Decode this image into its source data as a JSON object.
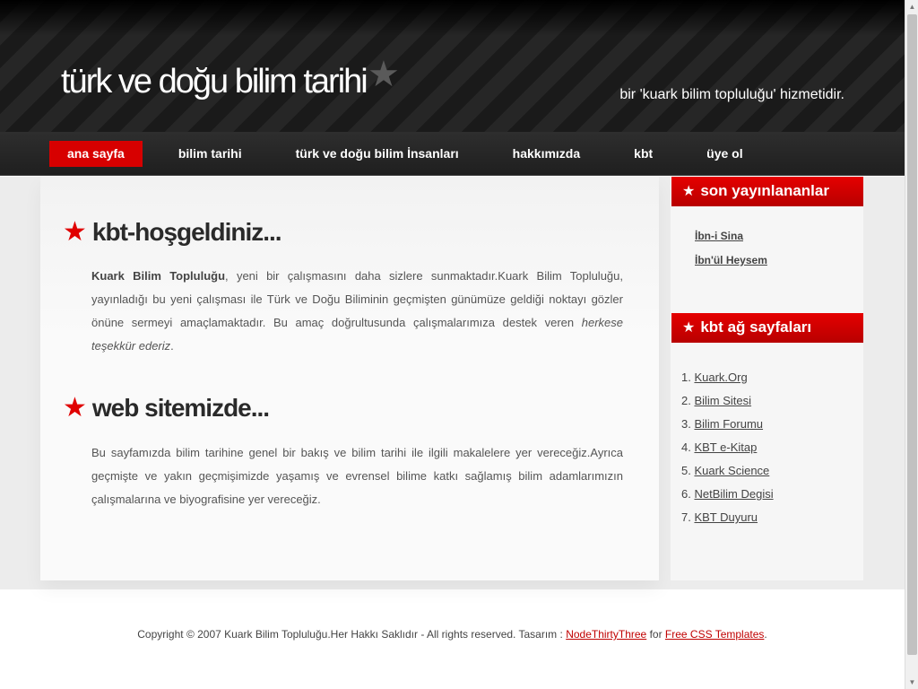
{
  "header": {
    "title": "türk ve doğu bilim tarihi",
    "title_star": "★",
    "tagline": "bir 'kuark bilim topluluğu' hizmetidir."
  },
  "nav": {
    "items": [
      {
        "label": "ana sayfa",
        "active": true
      },
      {
        "label": "bilim tarihi"
      },
      {
        "label": "türk ve doğu bilim İnsanları"
      },
      {
        "label": "hakkımızda"
      },
      {
        "label": "kbt"
      },
      {
        "label": "üye ol"
      }
    ]
  },
  "main": {
    "section1": {
      "star": "★",
      "title": "kbt-hoşgeldiniz...",
      "bold_lead": "Kuark Bilim Topluluğu",
      "text": ", yeni bir çalışmasını daha sizlere sunmaktadır.Kuark Bilim Topluluğu, yayınladığı bu yeni çalışması ile Türk ve Doğu Biliminin geçmişten günümüze geldiği noktayı gözler önüne sermeyi amaçlamaktadır. Bu amaç doğrultusunda çalışmalarımıza destek veren ",
      "italic": "herkese teşekkür ederiz",
      "end": "."
    },
    "section2": {
      "star": "★",
      "title": "web sitemizde...",
      "text": "Bu sayfamızda bilim tarihine genel bir bakış ve bilim tarihi ile ilgili makalelere yer vereceğiz.Ayrıca geçmişte ve yakın geçmişimizde yaşamış ve evrensel bilime katkı sağlamış bilim adamlarımızın çalışmalarına ve biyografisine yer vereceğiz."
    }
  },
  "sidebar": {
    "recent": {
      "star": "★",
      "title": "son yayınlananlar",
      "items": [
        "İbn-i Sina",
        "İbn'ül Heysem"
      ]
    },
    "network": {
      "star": "★",
      "title": "kbt ağ sayfaları",
      "items": [
        {
          "num": "1.",
          "label": "Kuark.Org"
        },
        {
          "num": "2.",
          "label": "Bilim Sitesi"
        },
        {
          "num": "3.",
          "label": "Bilim Forumu"
        },
        {
          "num": "4.",
          "label": "KBT e-Kitap"
        },
        {
          "num": "5.",
          "label": "Kuark Science"
        },
        {
          "num": "6.",
          "label": "NetBilim Degisi"
        },
        {
          "num": "7.",
          "label": "KBT Duyuru"
        }
      ]
    }
  },
  "footer": {
    "text1": "Copyright © 2007 Kuark Bilim Topluluğu.Her Hakkı Saklıdır - All rights reserved. Tasarım : ",
    "link1": "NodeThirtyThree",
    "text2": " for ",
    "link2": "Free CSS Templates",
    "text3": "."
  },
  "colors": {
    "accent": "#d70000",
    "header_bg": "#1a1a1a",
    "text": "#555555"
  }
}
